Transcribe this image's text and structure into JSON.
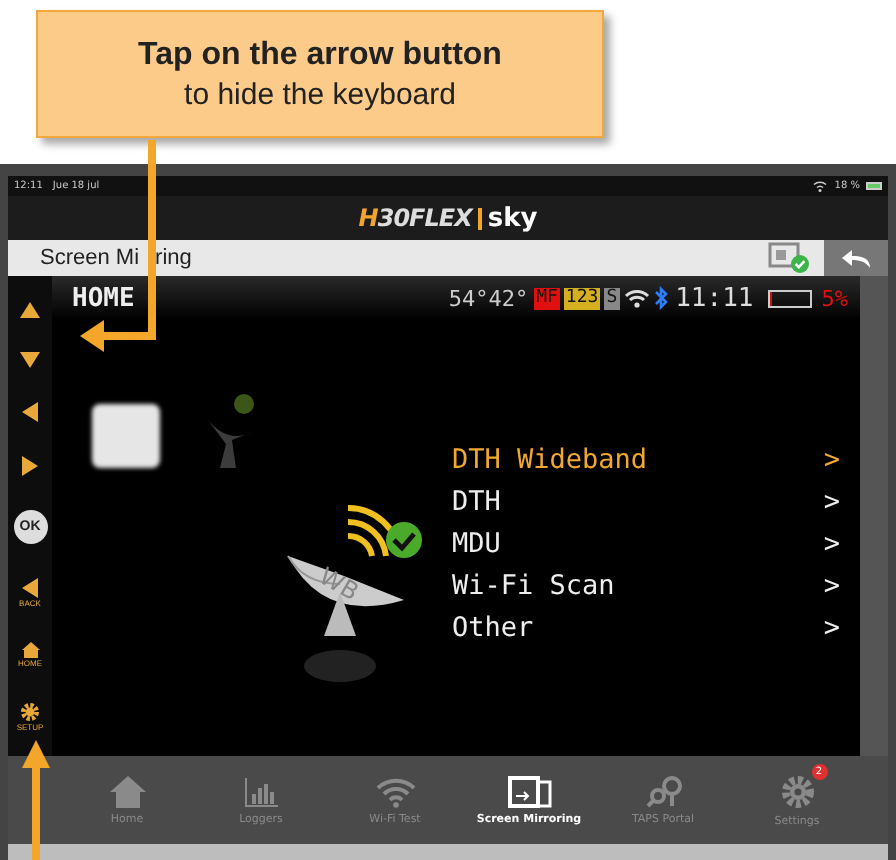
{
  "callout": {
    "title": "Tap on the arrow button",
    "subtitle": "to hide the keyboard"
  },
  "status_bar": {
    "time": "12:11",
    "date": "Jue 18 jul",
    "battery": "18 %"
  },
  "logo": {
    "brand": "H30FLEX",
    "partner": "sky"
  },
  "app_bar": {
    "title_parts": [
      "Screen Mi",
      "ring"
    ]
  },
  "dish_label": "WB",
  "device": {
    "header": {
      "title": "HOME",
      "coords": "54°42°",
      "badges": [
        {
          "text": "MF",
          "color": "#e01010"
        },
        {
          "text": "123",
          "color": "#d4b020"
        },
        {
          "text": "S",
          "color": "#888888"
        }
      ],
      "time": "11:11",
      "battery": {
        "level": 0.08
      },
      "battery_percent": "5%"
    },
    "side_buttons": [
      {
        "kind": "up"
      },
      {
        "kind": "down"
      },
      {
        "kind": "left"
      },
      {
        "kind": "right"
      },
      {
        "kind": "ok",
        "label": "OK"
      },
      {
        "kind": "back",
        "label": "BACK"
      },
      {
        "kind": "home",
        "label": "HOME"
      },
      {
        "kind": "setup",
        "label": "SETUP"
      }
    ],
    "menu": [
      {
        "label": "DTH Wideband",
        "arrow": ">",
        "selected": true
      },
      {
        "label": "DTH",
        "arrow": ">",
        "selected": false
      },
      {
        "label": "MDU",
        "arrow": ">",
        "selected": false
      },
      {
        "label": "Wi-Fi Scan",
        "arrow": ">",
        "selected": false
      },
      {
        "label": "Other",
        "arrow": ">",
        "selected": false
      }
    ]
  },
  "tabs": [
    {
      "kind": "home",
      "label": "Home",
      "selected": false
    },
    {
      "kind": "loggers",
      "label": "Loggers",
      "selected": false
    },
    {
      "kind": "wifi",
      "label": "Wi-Fi Test",
      "selected": false
    },
    {
      "kind": "mirroring",
      "label": "Screen Mirroring",
      "selected": true
    },
    {
      "kind": "portal",
      "label": "TAPS Portal",
      "selected": false
    },
    {
      "kind": "settings",
      "label": "Settings",
      "selected": false,
      "badge": "2"
    }
  ]
}
